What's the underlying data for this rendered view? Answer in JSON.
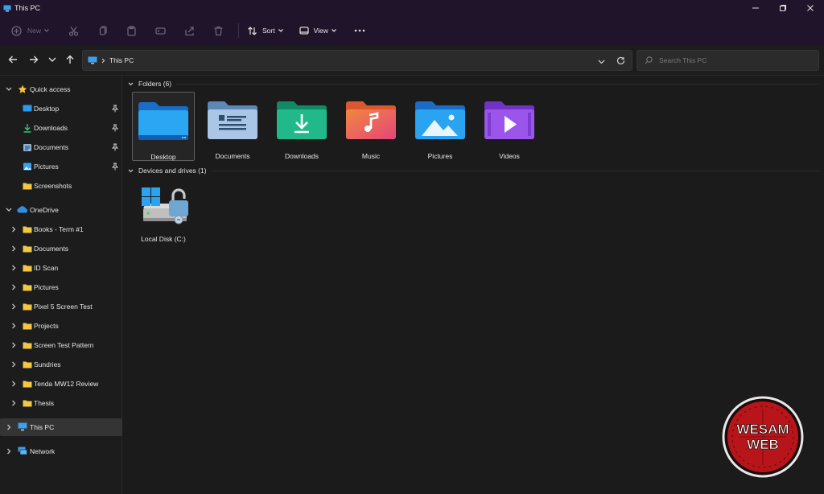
{
  "window": {
    "title": "This PC",
    "controls": {
      "minimize_icon": "minimize-icon",
      "restore_icon": "restore-icon",
      "close_icon": "close-icon"
    }
  },
  "commandbar": {
    "new_label": "New",
    "sort_label": "Sort",
    "view_label": "View",
    "more_icon": "ellipsis-icon",
    "disabled_icons": [
      "cut-icon",
      "copy-icon",
      "paste-icon",
      "rename-icon",
      "share-icon",
      "delete-icon"
    ]
  },
  "address": {
    "path": "This PC",
    "search_placeholder": "Search This PC"
  },
  "sidebar": {
    "quick_access": {
      "label": "Quick access",
      "items": [
        {
          "label": "Desktop",
          "icon": "desktop-icon",
          "pinned": true
        },
        {
          "label": "Downloads",
          "icon": "download-icon",
          "pinned": true
        },
        {
          "label": "Documents",
          "icon": "documents-icon",
          "pinned": true
        },
        {
          "label": "Pictures",
          "icon": "pictures-icon",
          "pinned": true
        },
        {
          "label": "Screenshots",
          "icon": "folder-icon",
          "pinned": false
        }
      ]
    },
    "onedrive": {
      "label": "OneDrive",
      "items": [
        {
          "label": "Books - Term #1"
        },
        {
          "label": "Documents"
        },
        {
          "label": "ID Scan"
        },
        {
          "label": "Pictures"
        },
        {
          "label": "Pixel 5 Screen Test"
        },
        {
          "label": "Projects"
        },
        {
          "label": "Screen Test Pattern"
        },
        {
          "label": "Sundries"
        },
        {
          "label": "Tenda MW12 Review"
        },
        {
          "label": "Thesis"
        }
      ]
    },
    "this_pc": {
      "label": "This PC"
    },
    "network": {
      "label": "Network"
    }
  },
  "main": {
    "folders_header": "Folders (6)",
    "folders": [
      {
        "label": "Desktop",
        "icon": "desktop-folder-icon",
        "selected": true
      },
      {
        "label": "Documents",
        "icon": "documents-folder-icon"
      },
      {
        "label": "Downloads",
        "icon": "downloads-folder-icon"
      },
      {
        "label": "Music",
        "icon": "music-folder-icon"
      },
      {
        "label": "Pictures",
        "icon": "pictures-folder-icon"
      },
      {
        "label": "Videos",
        "icon": "videos-folder-icon"
      }
    ],
    "drives_header": "Devices and drives (1)",
    "drives": [
      {
        "label": "Local Disk (C:)",
        "icon": "local-disk-icon"
      }
    ]
  },
  "colors": {
    "titlebar_bg": "#20142a",
    "window_bg": "#1b1b1b",
    "folder_yellow": "#f3c742",
    "accent_blue": "#2b9bf0"
  },
  "watermark": {
    "line1": "WESAM",
    "line2": "WEB"
  }
}
